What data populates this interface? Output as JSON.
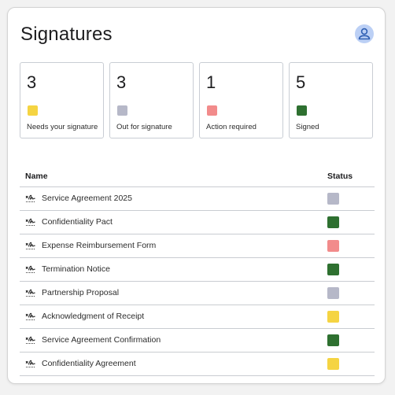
{
  "header": {
    "title": "Signatures",
    "avatar_icon": "user-icon",
    "avatar_color": "#bcd0f5",
    "avatar_icon_color": "#2f5fb3"
  },
  "summary": [
    {
      "count": "3",
      "label": "Needs your signature",
      "color": "#f5d442",
      "key": "needs_signature"
    },
    {
      "count": "3",
      "label": "Out for signature",
      "color": "#b6b8c8",
      "key": "out_for_signature"
    },
    {
      "count": "1",
      "label": "Action required",
      "color": "#f28b8b",
      "key": "action_required"
    },
    {
      "count": "5",
      "label": "Signed",
      "color": "#2e7030",
      "key": "signed"
    }
  ],
  "table": {
    "columns": [
      "Name",
      "Status"
    ],
    "row_icon": "signature-icon",
    "rows": [
      {
        "name": "Service Agreement 2025",
        "status": "out_for_signature"
      },
      {
        "name": "Confidentiality Pact",
        "status": "signed"
      },
      {
        "name": "Expense Reimbursement Form",
        "status": "action_required"
      },
      {
        "name": "Termination Notice",
        "status": "signed"
      },
      {
        "name": "Partnership Proposal",
        "status": "out_for_signature"
      },
      {
        "name": "Acknowledgment of Receipt",
        "status": "needs_signature"
      },
      {
        "name": "Service Agreement Confirmation",
        "status": "signed"
      },
      {
        "name": "Confidentiality Agreement",
        "status": "needs_signature"
      }
    ]
  }
}
